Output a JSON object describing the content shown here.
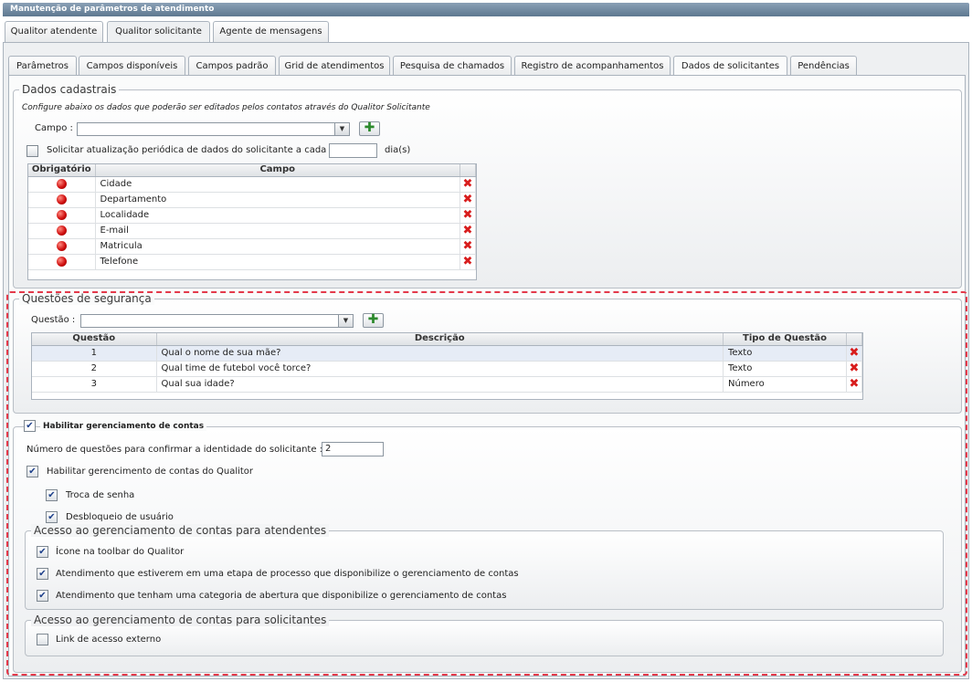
{
  "window": {
    "title": "Manutenção de parâmetros de atendimento"
  },
  "top_tabs": [
    "Qualitor atendente",
    "Qualitor solicitante",
    "Agente de mensagens"
  ],
  "sub_tabs": [
    "Parâmetros",
    "Campos disponíveis",
    "Campos padrão",
    "Grid de atendimentos",
    "Pesquisa de chamados",
    "Registro de acompanhamentos",
    "Dados de solicitantes",
    "Pendências"
  ],
  "dados": {
    "legend": "Dados cadastrais",
    "description": "Configure abaixo os dados que poderão ser editados pelos contatos através do Qualitor Solicitante",
    "campo_label": "Campo :",
    "campo_value": "",
    "periodic_label": "Solicitar atualização periódica de dados do solicitante a cada",
    "periodic_value": "",
    "days_label": "dia(s)",
    "grid": {
      "headers": [
        "Obrigatório",
        "Campo",
        ""
      ],
      "rows": [
        "Cidade",
        "Departamento",
        "Localidade",
        "E-mail",
        "Matricula",
        "Telefone"
      ]
    }
  },
  "seguranca": {
    "legend": "Questões de segurança",
    "questao_label": "Questão :",
    "questao_value": "",
    "grid": {
      "headers": [
        "Questão",
        "Descrição",
        "Tipo de Questão",
        ""
      ],
      "rows": [
        {
          "num": "1",
          "desc": "Qual o nome de sua mãe?",
          "tipo": "Texto"
        },
        {
          "num": "2",
          "desc": "Qual time de futebol você torce?",
          "tipo": "Texto"
        },
        {
          "num": "3",
          "desc": "Qual sua idade?",
          "tipo": "Número"
        }
      ]
    }
  },
  "contas": {
    "enable_label": "Habilitar gerenciamento de contas",
    "num_questoes_label": "Número de questões para confirmar a identidade do solicitante :",
    "num_questoes_value": "2",
    "qualitor_label": "Habilitar gerencimento de contas do Qualitor",
    "troca_label": "Troca de senha",
    "desbloqueio_label": "Desbloqueio de usuário",
    "atendentes": {
      "legend": "Acesso ao gerenciamento de contas para atendentes",
      "items": [
        "Ícone na toolbar do Qualitor",
        "Atendimento que estiverem em uma etapa de processo que disponibilize o gerenciamento de contas",
        "Atendimento que tenham uma categoria de abertura que disponibilize o gerenciamento de contas"
      ]
    },
    "solicitantes": {
      "legend": "Acesso ao gerenciamento de contas para solicitantes",
      "items": [
        "Link de acesso externo"
      ]
    }
  },
  "icons": {
    "check": "✔",
    "add": "✚",
    "delete": "✖",
    "arrow": "▼"
  }
}
